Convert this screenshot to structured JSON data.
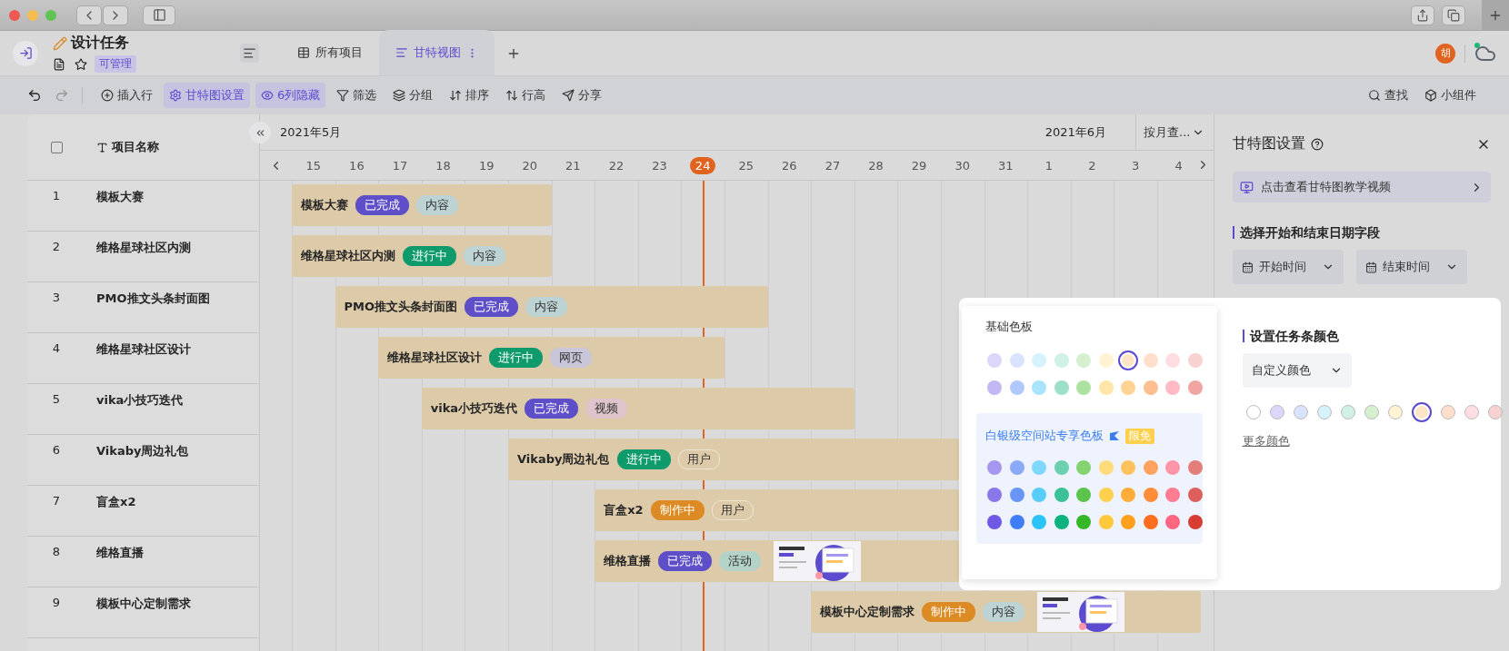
{
  "app": {
    "title": "设计任务",
    "permission": "可管理",
    "avatar": "胡",
    "tabs": [
      {
        "label": "所有项目",
        "selected": false
      },
      {
        "label": "甘特视图",
        "selected": true
      }
    ]
  },
  "toolbar": {
    "left": [
      {
        "label": "插入行",
        "active": false
      },
      {
        "label": "甘特图设置",
        "active": true
      },
      {
        "label": "6列隐藏",
        "active": true
      },
      {
        "label": "筛选",
        "active": false
      },
      {
        "label": "分组",
        "active": false
      },
      {
        "label": "排序",
        "active": false
      },
      {
        "label": "行高",
        "active": false
      },
      {
        "label": "分享",
        "active": false
      }
    ],
    "right": [
      {
        "label": "查找"
      },
      {
        "label": "小组件"
      }
    ]
  },
  "table": {
    "select_all": {
      "checked": false
    },
    "column": "项目名称",
    "rows": [
      {
        "number": "1",
        "name": "模板大赛"
      },
      {
        "number": "2",
        "name": "维格星球社区内测"
      },
      {
        "number": "3",
        "name": "PMO推文头条封面图"
      },
      {
        "number": "4",
        "name": "维格星球社区设计"
      },
      {
        "number": "5",
        "name": "vika小技巧迭代"
      },
      {
        "number": "6",
        "name": "Vikaby周边礼包"
      },
      {
        "number": "7",
        "name": "盲盒x2"
      },
      {
        "number": "8",
        "name": "维格直播"
      },
      {
        "number": "9",
        "name": "模板中心定制需求"
      }
    ]
  },
  "gantt": {
    "months": [
      "2021年5月",
      "2021年6月"
    ],
    "scale": "按月查...",
    "days": [
      {
        "label": "15",
        "selected": false
      },
      {
        "label": "16",
        "selected": false
      },
      {
        "label": "17",
        "selected": false
      },
      {
        "label": "18",
        "selected": false
      },
      {
        "label": "19",
        "selected": false
      },
      {
        "label": "20",
        "selected": false
      },
      {
        "label": "21",
        "selected": false
      },
      {
        "label": "22",
        "selected": false
      },
      {
        "label": "23",
        "selected": false
      },
      {
        "label": "24",
        "selected": true
      },
      {
        "label": "25",
        "selected": false
      },
      {
        "label": "26",
        "selected": false
      },
      {
        "label": "27",
        "selected": false
      },
      {
        "label": "28",
        "selected": false
      },
      {
        "label": "29",
        "selected": false
      },
      {
        "label": "30",
        "selected": false
      },
      {
        "label": "31",
        "selected": false
      },
      {
        "label": "1",
        "selected": false
      },
      {
        "label": "2",
        "selected": false
      },
      {
        "label": "3",
        "selected": false
      },
      {
        "label": "4",
        "selected": false
      }
    ],
    "bars": [
      {
        "name": "模板大赛",
        "status": {
          "text": "已完成",
          "color": "#5e4fc8"
        },
        "category": {
          "text": "内容",
          "color": "#bed3d4",
          "outlined": false
        }
      },
      {
        "name": "维格星球社区内测",
        "status": {
          "text": "进行中",
          "color": "#0f9a6c"
        },
        "category": {
          "text": "内容",
          "color": "#bed3d4",
          "outlined": false
        }
      },
      {
        "name": "PMO推文头条封面图",
        "status": {
          "text": "已完成",
          "color": "#5e4fc8"
        },
        "category": {
          "text": "内容",
          "color": "#bed3d4",
          "outlined": false
        }
      },
      {
        "name": "维格星球社区设计",
        "status": {
          "text": "进行中",
          "color": "#0f9a6c"
        },
        "category": {
          "text": "网页",
          "color": "#c8c6d8",
          "outlined": false
        }
      },
      {
        "name": "vika小技巧迭代",
        "status": {
          "text": "已完成",
          "color": "#5e4fc8"
        },
        "category": {
          "text": "视频",
          "color": "#dfc5cb",
          "outlined": false
        }
      },
      {
        "name": "Vikaby周边礼包",
        "status": {
          "text": "进行中",
          "color": "#0f9a6c"
        },
        "category": {
          "text": "用户",
          "color": "#dccaa8",
          "outlined": true
        }
      },
      {
        "name": "盲盒x2",
        "status": {
          "text": "制作中",
          "color": "#dc8a23"
        },
        "category": {
          "text": "用户",
          "color": "#dccaa8",
          "outlined": true
        }
      },
      {
        "name": "维格直播",
        "status": {
          "text": "已完成",
          "color": "#5e4fc8"
        },
        "category": {
          "text": "活动",
          "color": "#b4d3c8",
          "outlined": false
        }
      },
      {
        "name": "模板中心定制需求",
        "status": {
          "text": "制作中",
          "color": "#dc8a23"
        },
        "category": {
          "text": "内容",
          "color": "#bed3d4",
          "outlined": false
        }
      }
    ]
  },
  "panel": {
    "title": "甘特图设置",
    "video_link": "点击查看甘特图教学视频",
    "date_section": "选择开始和结束日期字段",
    "start_field": "开始时间",
    "end_field": "结束时间",
    "color_section": "设置任务条颜色",
    "color_mode": "自定义颜色",
    "more_colors": "更多颜色",
    "colors": [
      {
        "color": "#ffffff",
        "selected": false
      },
      {
        "color": "#ddd6fb",
        "selected": false
      },
      {
        "color": "#d9e3fd",
        "selected": false
      },
      {
        "color": "#d6f2fc",
        "selected": false
      },
      {
        "color": "#d1f0e6",
        "selected": false
      },
      {
        "color": "#d6efcf",
        "selected": false
      },
      {
        "color": "#fff3d4",
        "selected": false
      },
      {
        "color": "#ffe5c7",
        "selected": true
      },
      {
        "color": "#ffdfcb",
        "selected": false
      },
      {
        "color": "#ffdde3",
        "selected": false
      },
      {
        "color": "#f8d2d1",
        "selected": false
      }
    ]
  },
  "palette": {
    "basic_title": "基础色板",
    "premium_title": "白银级空间站专享色板",
    "premium_badge": "限免",
    "basic_rows": [
      [
        {
          "color": "#ddd6fb",
          "selected": false
        },
        {
          "color": "#d9e3fd",
          "selected": false
        },
        {
          "color": "#d6f2fc",
          "selected": false
        },
        {
          "color": "#d1f0e6",
          "selected": false
        },
        {
          "color": "#d6efcf",
          "selected": false
        },
        {
          "color": "#fff3d4",
          "selected": false
        },
        {
          "color": "#ffe5c7",
          "selected": true
        },
        {
          "color": "#ffdfcb",
          "selected": false
        },
        {
          "color": "#ffdde3",
          "selected": false
        },
        {
          "color": "#f8d2d1",
          "selected": false
        }
      ],
      [
        {
          "color": "#c3b8f5",
          "selected": false
        },
        {
          "color": "#b0c8fb",
          "selected": false
        },
        {
          "color": "#a8e4fb",
          "selected": false
        },
        {
          "color": "#9ce0ca",
          "selected": false
        },
        {
          "color": "#ade3a0",
          "selected": false
        },
        {
          "color": "#ffe6a8",
          "selected": false
        },
        {
          "color": "#ffd393",
          "selected": false
        },
        {
          "color": "#ffbe8f",
          "selected": false
        },
        {
          "color": "#ffbac6",
          "selected": false
        },
        {
          "color": "#f0a5a3",
          "selected": false
        }
      ]
    ],
    "premium_rows": [
      [
        {
          "color": "#a597ef",
          "selected": false
        },
        {
          "color": "#8aaaf8",
          "selected": false
        },
        {
          "color": "#7fd8fb",
          "selected": false
        },
        {
          "color": "#6bd0b0",
          "selected": false
        },
        {
          "color": "#84d36e",
          "selected": false
        },
        {
          "color": "#ffdb7a",
          "selected": false
        },
        {
          "color": "#ffc25e",
          "selected": false
        },
        {
          "color": "#ffa35e",
          "selected": false
        },
        {
          "color": "#ff96a8",
          "selected": false
        },
        {
          "color": "#e57e7a",
          "selected": false
        }
      ],
      [
        {
          "color": "#8a77ea",
          "selected": false
        },
        {
          "color": "#6895f7",
          "selected": false
        },
        {
          "color": "#58cdfa",
          "selected": false
        },
        {
          "color": "#3cc196",
          "selected": false
        },
        {
          "color": "#5cc44a",
          "selected": false
        },
        {
          "color": "#ffd04e",
          "selected": false
        },
        {
          "color": "#ffac38",
          "selected": false
        },
        {
          "color": "#ff8d3a",
          "selected": false
        },
        {
          "color": "#ff7d93",
          "selected": false
        },
        {
          "color": "#dd5f5b",
          "selected": false
        }
      ],
      [
        {
          "color": "#6f58e6",
          "selected": false
        },
        {
          "color": "#3f7ef5",
          "selected": false
        },
        {
          "color": "#2bc4f8",
          "selected": false
        },
        {
          "color": "#0cb27e",
          "selected": false
        },
        {
          "color": "#35b727",
          "selected": false
        },
        {
          "color": "#ffc93b",
          "selected": false
        },
        {
          "color": "#ffa11f",
          "selected": false
        },
        {
          "color": "#ff6f1f",
          "selected": false
        },
        {
          "color": "#ff6680",
          "selected": false
        },
        {
          "color": "#d83d35",
          "selected": false
        }
      ]
    ]
  }
}
